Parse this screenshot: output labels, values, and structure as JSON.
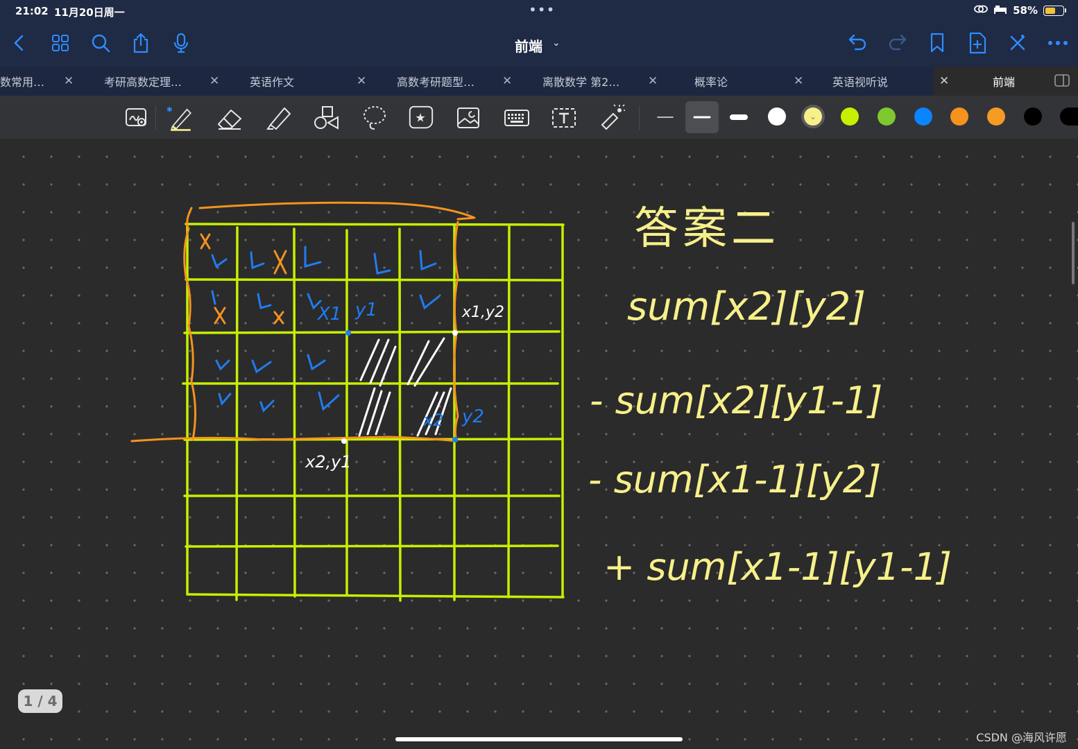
{
  "status": {
    "time": "21:02",
    "date": "11月20日周一",
    "battery": "58%"
  },
  "nav": {
    "title": "前端",
    "icons": [
      "back-icon",
      "grid-icon",
      "search-icon",
      "share-icon",
      "mic-icon",
      "undo-icon",
      "redo-icon",
      "bookmark-icon",
      "add-page-icon",
      "close-cross-icon",
      "more-icon"
    ]
  },
  "tabs": [
    {
      "label": "数常用…"
    },
    {
      "label": "考研高数定理…"
    },
    {
      "label": "英语作文"
    },
    {
      "label": "高数考研题型…"
    },
    {
      "label": "离散数学 第2…"
    },
    {
      "label": "概率论"
    },
    {
      "label": "英语视听说"
    },
    {
      "label": "前端",
      "active": true
    }
  ],
  "toolbar": {
    "tools": [
      "zoom-window-icon",
      "pen-icon",
      "eraser-icon",
      "highlighter-icon",
      "shapes-icon",
      "lasso-icon",
      "sticker-icon",
      "image-icon",
      "keyboard-icon",
      "text-icon",
      "laser-pointer-icon"
    ],
    "colors": [
      "#ffffff",
      "#f7f08a",
      "#c6f000",
      "#7dc92f",
      "#0a84ff",
      "#f5931e",
      "#f59a23",
      "#000000"
    ],
    "selected_color": "#f7f08a"
  },
  "note": {
    "heading": "答案二",
    "formula_lines": [
      "sum[x2][y2]",
      "- sum[x2][y1-1]",
      "- sum[x1-1][y2]",
      "+ sum[x1-1][y1-1]"
    ],
    "grid_labels": {
      "x1": "X1",
      "y1": "y1",
      "x1y2": "x1,y2",
      "x2": "x2",
      "y2": "y2",
      "x2y1": "x2,y1"
    }
  },
  "page_indicator": "1 / 4",
  "watermark": "CSDN @海风许愿"
}
